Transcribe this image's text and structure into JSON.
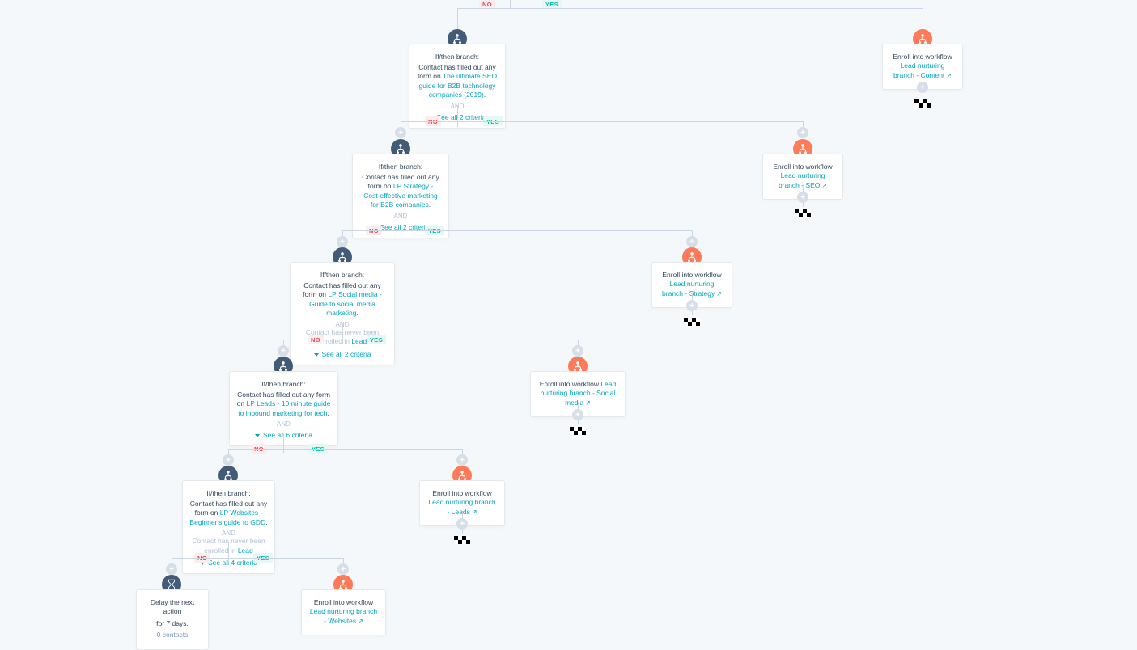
{
  "branches": {
    "b0_no": "NO",
    "b0_yes": "YES",
    "b1": {
      "title": "If/then branch:",
      "body_pre": "Contact has filled out any form on ",
      "body_link": "The ultimate SEO guide for B2B technology companies (2019)",
      "body_post": ".",
      "and": "AND",
      "see": "See all 2 criteria"
    },
    "b1_no": "NO",
    "b1_yes": "YES",
    "e1": {
      "body_pre": "Enroll into workflow ",
      "body_link": "Lead nurturing branch - Content"
    },
    "b2": {
      "title": "If/then branch:",
      "body_pre": "Contact has filled out any form on ",
      "body_link": "LP Strategy - Cost-effective marketing for B2B companies",
      "body_post": ".",
      "and": "AND",
      "see": "See all 2 criteria"
    },
    "b2_no": "NO",
    "b2_yes": "YES",
    "e2": {
      "body_pre": "Enroll into workflow ",
      "body_link": "Lead nurturing branch - SEO"
    },
    "b3": {
      "title": "If/then branch:",
      "body_pre": "Contact has filled out any form on ",
      "body_link": "LP Social media - Guide to social media marketing",
      "body_post": ".",
      "and": "AND",
      "body2_pre": "Contact has never been enrolled in ",
      "body2_link": "Lead",
      "see": "See all 2 criteria"
    },
    "b3_no": "NO",
    "b3_yes": "YES",
    "e3": {
      "body_pre": "Enroll into workflow ",
      "body_link": "Lead nurturing branch - Strategy"
    },
    "b4": {
      "title": "If/then branch:",
      "body_pre": "Contact has filled out any form on ",
      "body_link": "LP Leads - 10 minute guide to inbound marketing for tech",
      "body_post": ".",
      "and": "AND",
      "see": "See all 6 criteria"
    },
    "b4_no": "NO",
    "b4_yes": "YES",
    "e4": {
      "body_pre": "Enroll into workflow ",
      "body_link": "Lead nurturing branch - Social media"
    },
    "b5": {
      "title": "If/then branch:",
      "body_pre": "Contact has filled out any form on ",
      "body_link": "LP Websites - Beginner's guide to GDD",
      "body_post": ".",
      "and": "AND",
      "body2_pre": "Contact has never been enrolled in ",
      "body2_link": "Lead",
      "see": "See all 4 criteria"
    },
    "b5_no": "NO",
    "b5_yes": "YES",
    "e5": {
      "body_pre": "Enroll into workflow ",
      "body_link": "Lead nurturing branch - Leads"
    },
    "d6": {
      "line1": "Delay the next action",
      "line2": "for 7 days.",
      "line3": "0 contacts"
    },
    "e6": {
      "body_pre": "Enroll into workflow ",
      "body_link": "Lead nurturing branch - Websites"
    }
  }
}
